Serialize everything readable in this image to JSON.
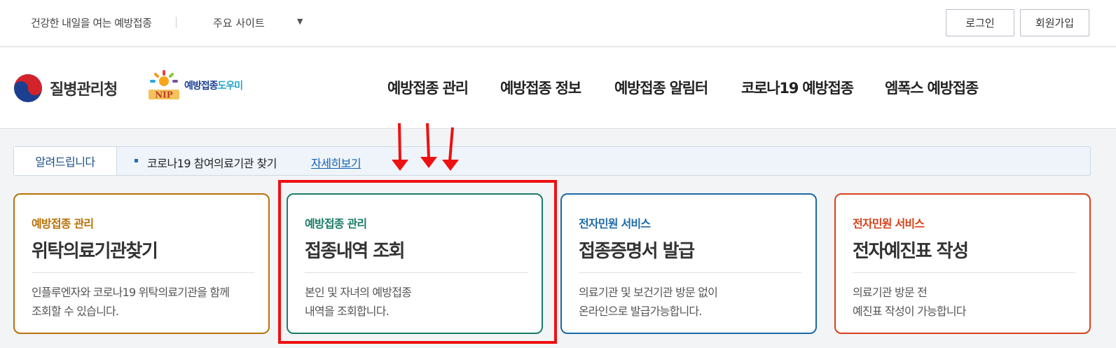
{
  "topbar": {
    "slogan": "건강한 내일을 여는 예방접종",
    "site_select_label": "주요 사이트",
    "login_label": "로그인",
    "join_label": "회원가입"
  },
  "header": {
    "kdca_name": "질병관리청",
    "nip_logo_text_1": "예방접종",
    "nip_logo_text_2": "도우미",
    "nip_logo_mark_text": "NIP",
    "menu": [
      "예방접종 관리",
      "예방접종 정보",
      "예방접종 알림터",
      "코로나19 예방접종",
      "엠폭스 예방접종"
    ]
  },
  "notice": {
    "label": "알려드립니다",
    "message": "코로나19 참여의료기관 찾기",
    "more_link": "자세히보기"
  },
  "cards": [
    {
      "category": "예방접종 관리",
      "title": "위탁의료기관찾기",
      "desc_line1": "인플루엔자와 코로나19 위탁의료기관을 함께",
      "desc_line2": "조회할 수 있습니다.",
      "color": "#b8720a"
    },
    {
      "category": "예방접종 관리",
      "title": "접종내역 조회",
      "desc_line1": "본인 및 자녀의 예방접종",
      "desc_line2": "내역을 조회합니다.",
      "color": "#1a7d68"
    },
    {
      "category": "전자민원 서비스",
      "title": "접종증명서 발급",
      "desc_line1": "의료기관 및 보건기관 방문 없이",
      "desc_line2": "온라인으로 발급가능합니다.",
      "color": "#1c6aa8"
    },
    {
      "category": "전자민원 서비스",
      "title": "전자예진표 작성",
      "desc_line1": "의료기관 방문 전",
      "desc_line2": "예진표 작성이 가능합니다",
      "color": "#d8411a"
    }
  ],
  "annotation": {
    "highlight_color": "#ee1111",
    "arrow_count": 3
  }
}
